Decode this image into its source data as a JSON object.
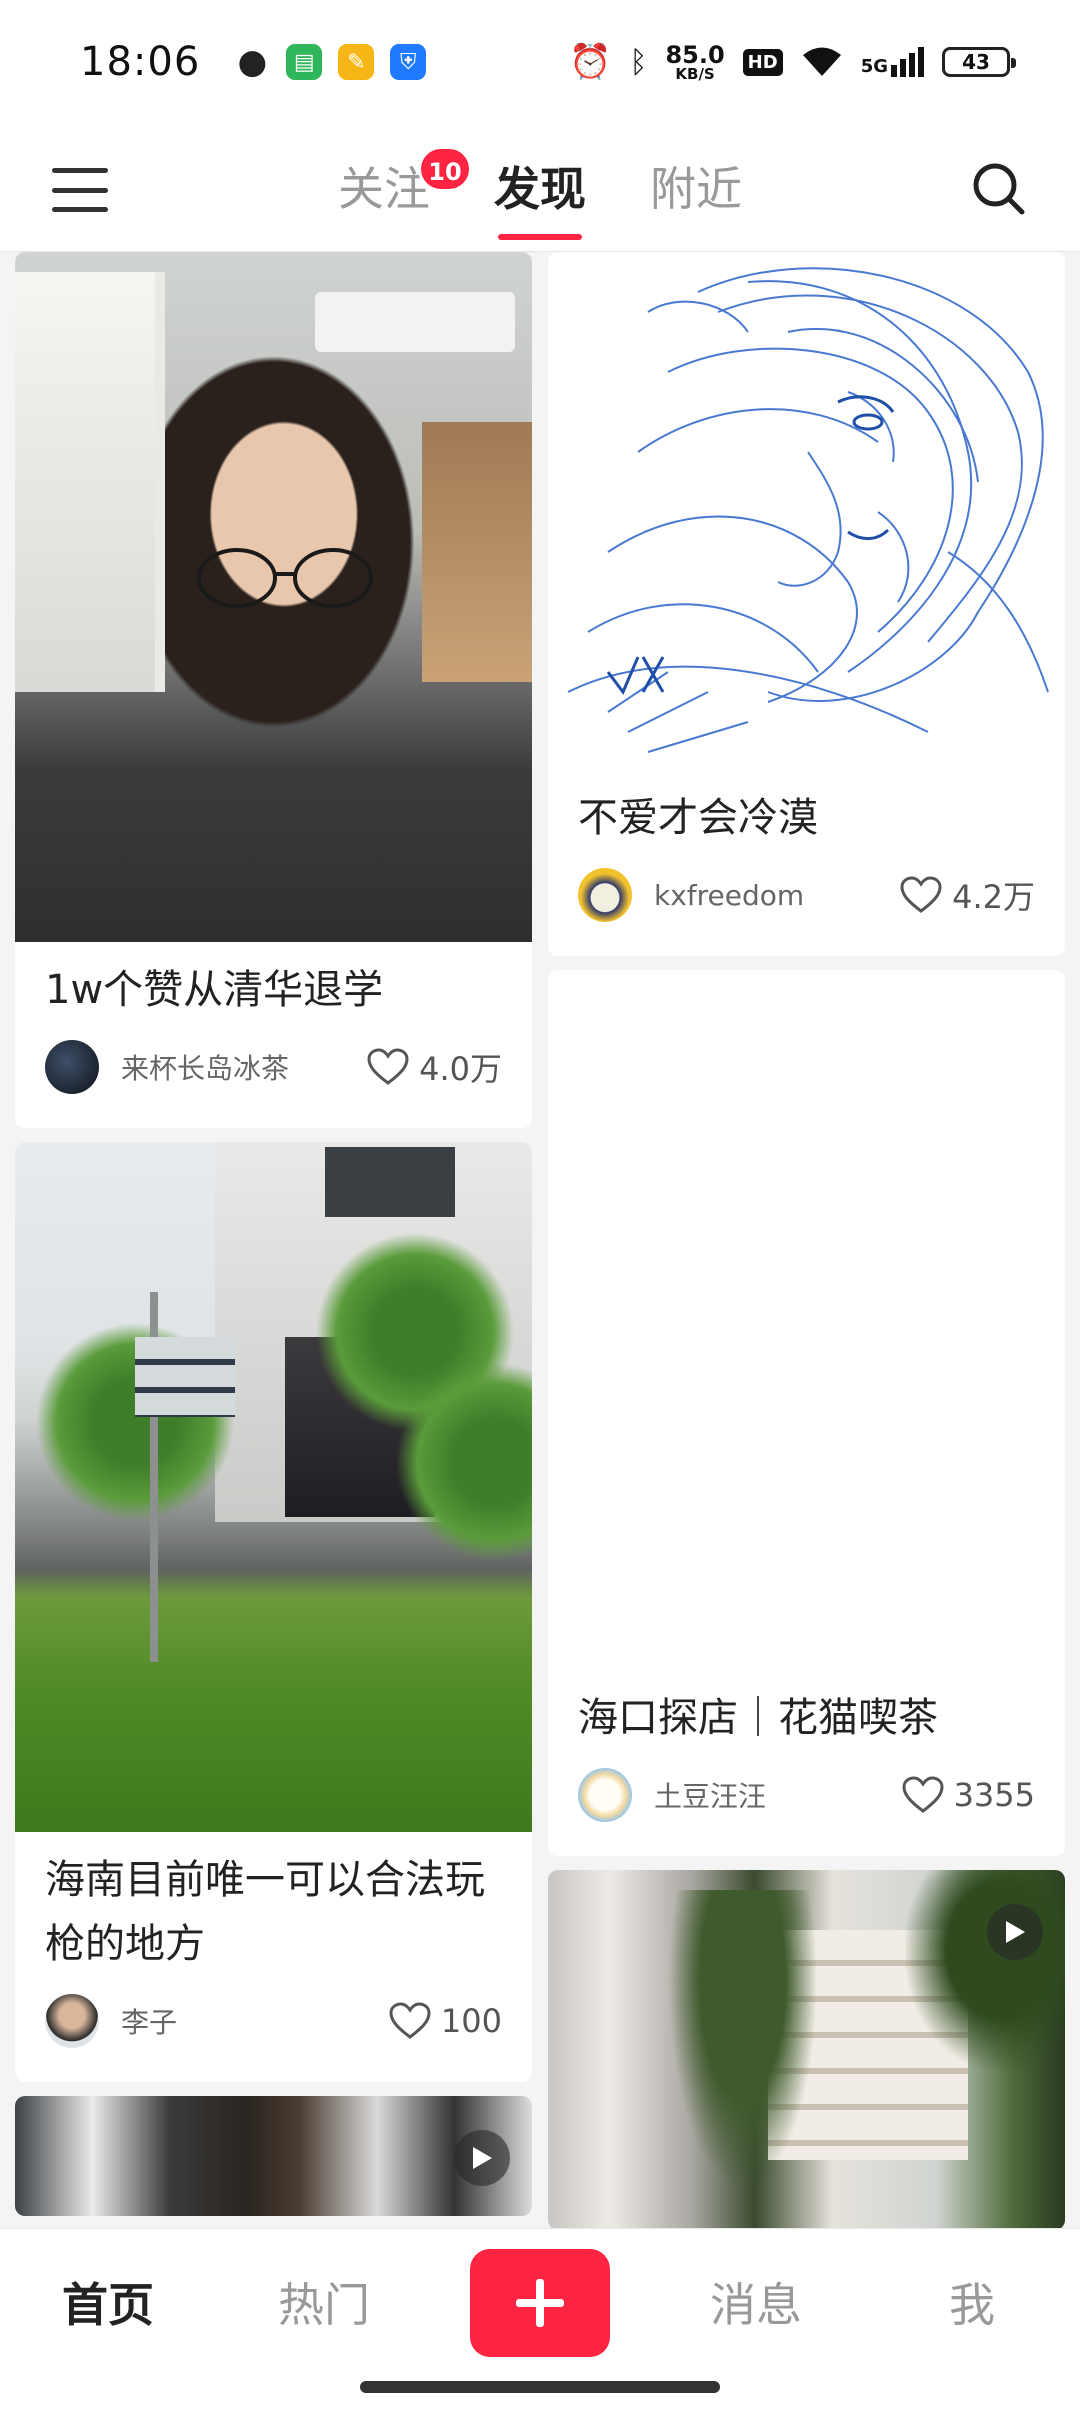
{
  "status_bar": {
    "time": "18:06",
    "net_speed_value": "85.0",
    "net_speed_unit": "KB/S",
    "hd_label": "HD",
    "network_label": "5G",
    "battery": "43",
    "icons": [
      "wechat-icon",
      "messages-icon",
      "notes-icon",
      "security-icon",
      "alarm-icon",
      "bluetooth-icon",
      "wifi-icon",
      "signal-icon",
      "battery-icon"
    ]
  },
  "top_nav": {
    "tabs": [
      {
        "label": "关注",
        "badge": "10",
        "active": false
      },
      {
        "label": "发现",
        "active": true
      },
      {
        "label": "附近",
        "active": false
      }
    ],
    "accent_color": "#ff2442"
  },
  "feed": {
    "left": [
      {
        "title": "1w个赞从清华退学",
        "author": "来杯长岛冰茶",
        "likes": "4.0万"
      },
      {
        "title": "海南目前唯一可以合法玩枪的地方",
        "author": "李子",
        "likes": "100"
      }
    ],
    "right": [
      {
        "title": "不爱才会冷漠",
        "author": "kxfreedom",
        "likes": "4.2万"
      },
      {
        "title": "海口探店｜花猫喫茶",
        "author": "土豆汪汪",
        "likes": "3355"
      }
    ]
  },
  "bottom_nav": {
    "items": [
      {
        "label": "首页",
        "active": true
      },
      {
        "label": "热门",
        "active": false
      },
      {
        "label": "消息",
        "active": false
      },
      {
        "label": "我",
        "active": false
      }
    ],
    "post_button_label": "+"
  }
}
